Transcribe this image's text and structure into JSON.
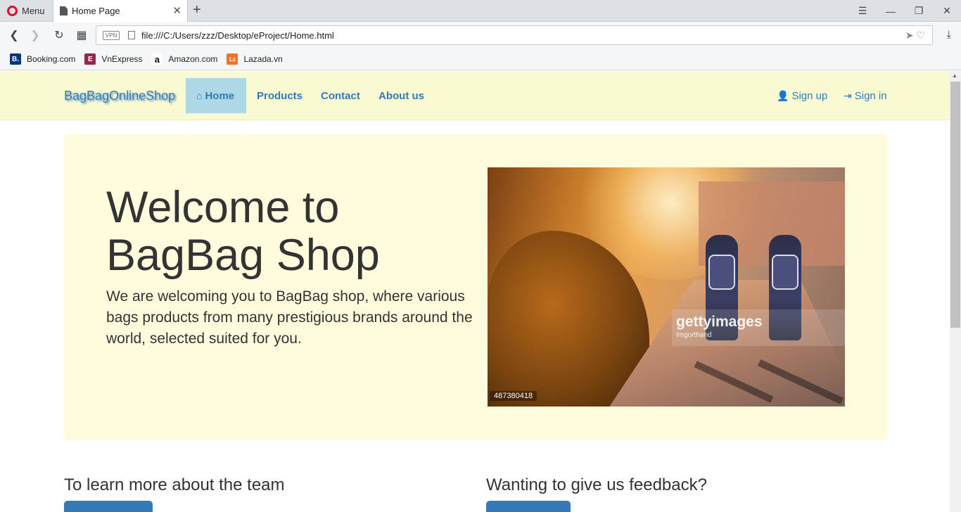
{
  "browser": {
    "menu_label": "Menu",
    "tab_title": "Home Page",
    "url": "file:///C:/Users/zzz/Desktop/eProject/Home.html",
    "vpn_label": "VPN",
    "bookmarks": [
      {
        "label": "Booking.com",
        "icon": "booking-icon",
        "color": "#003580",
        "glyph": "B."
      },
      {
        "label": "VnExpress",
        "icon": "vnexpress-icon",
        "color": "#9f224e",
        "glyph": "E"
      },
      {
        "label": "Amazon.com",
        "icon": "amazon-icon",
        "color": "#ffffff",
        "glyph": "a"
      },
      {
        "label": "Lazada.vn",
        "icon": "lazada-icon",
        "color": "#f57224",
        "glyph": "Lz"
      }
    ]
  },
  "site": {
    "brand": "BagBagOnlineShop",
    "nav": {
      "home": "Home",
      "products": "Products",
      "contact": "Contact",
      "about": "About us",
      "signup": "Sign up",
      "signin": "Sign in"
    },
    "hero": {
      "title": "Welcome to BagBag Shop",
      "text": "We are welcoming you to BagBag shop, where various bags products from many prestigious brands around the world, selected suited for you.",
      "image": {
        "watermark": "gettyimages",
        "credit": "Imgorthand",
        "id": "487380418"
      }
    },
    "sections": {
      "team": "To learn more about the team",
      "feedback": "Wanting to give us feedback?"
    },
    "colors": {
      "navbar_bg": "#fafad2",
      "jumbotron_bg": "#fffcdd",
      "link": "#337ab7",
      "active_nav": "#add8e6"
    }
  }
}
